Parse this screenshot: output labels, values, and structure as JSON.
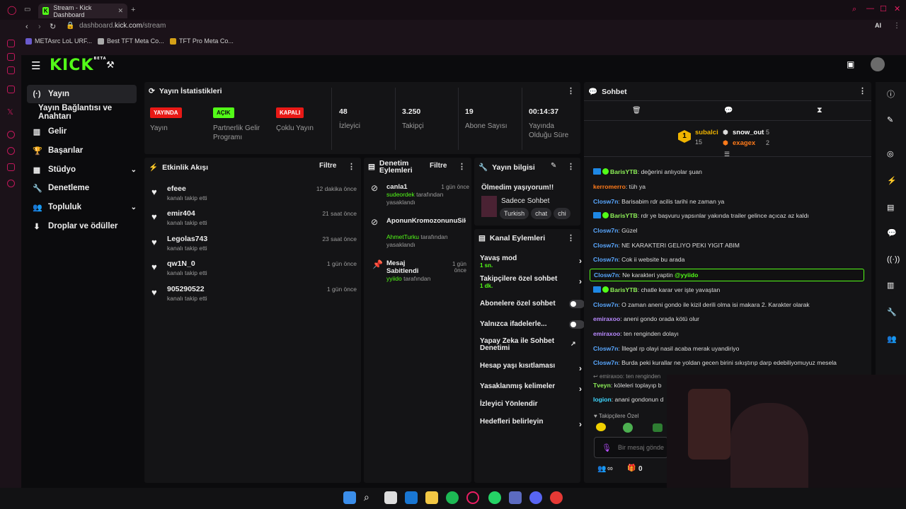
{
  "browser": {
    "tab_title": "Stream - Kick Dashboard",
    "url_host": "dashboard.",
    "url_domain": "kick.com",
    "url_path": "/stream",
    "bookmarks": [
      "METAsrc LoL URF...",
      "Best TFT Meta Co...",
      "TFT Pro Meta Co..."
    ],
    "ai_label": "AI"
  },
  "nav": {
    "logo": "KICK",
    "logo_sup": "BETA",
    "items": [
      {
        "label": "Yayın",
        "icon": "(·)"
      },
      {
        "label": "Yayın Bağlantısı ve Anahtarı",
        "icon": ""
      },
      {
        "label": "Gelir",
        "icon": "▥"
      },
      {
        "label": "Başarılar",
        "icon": "🏆"
      },
      {
        "label": "Stüdyo",
        "icon": "▦"
      },
      {
        "label": "Denetleme",
        "icon": "🔧"
      },
      {
        "label": "Topluluk",
        "icon": "👥"
      },
      {
        "label": "Droplar ve ödüller",
        "icon": "⬇"
      }
    ]
  },
  "stats": {
    "title": "Yayın İstatistikleri",
    "items": [
      {
        "badge": "YAYINDA",
        "label": "Yayın"
      },
      {
        "badge": "AÇIK",
        "label": "Partnerlik Gelir Programı"
      },
      {
        "badge": "KAPALI",
        "label": "Çoklu Yayın"
      },
      {
        "value": "48",
        "label": "İzleyici"
      },
      {
        "value": "3.250",
        "label": "Takipçi"
      },
      {
        "value": "19",
        "label": "Abone Sayısı"
      },
      {
        "value": "00:14:37",
        "label": "Yayında Olduğu Süre"
      }
    ]
  },
  "activity": {
    "title": "Etkinlik Akışı",
    "filter": "Filtre",
    "items": [
      {
        "name": "efeee",
        "sub": "kanalı takip etti",
        "time": "12 dakika önce"
      },
      {
        "name": "emir404",
        "sub": "kanalı takip etti",
        "time": "21 saat önce"
      },
      {
        "name": "Legolas743",
        "sub": "kanalı takip etti",
        "time": "23 saat önce"
      },
      {
        "name": "qw1N_0",
        "sub": "kanalı takip etti",
        "time": "1 gün önce"
      },
      {
        "name": "905290522",
        "sub": "kanalı takip etti",
        "time": "1 gün önce"
      }
    ]
  },
  "moderation": {
    "title": "Denetim Eylemleri",
    "filter": "Filtre",
    "items": [
      {
        "name": "canla1",
        "by": "sudeordek",
        "by_suffix": "tarafından",
        "action": "yasaklandı",
        "time": "1 gün önce"
      },
      {
        "name": "AponunKromozonunuSik",
        "by": "AhmetTurku",
        "by_suffix": "tarafından",
        "action": "yasaklandı",
        "time": ""
      },
      {
        "name": "Mesaj Sabitlendi",
        "by": "yyiido",
        "by_suffix": "tarafından",
        "action": "",
        "time": "1 gün önce"
      }
    ]
  },
  "stream_info": {
    "title": "Yayın bilgisi",
    "stream_title": "Ölmedim yaşıyorum!!",
    "category": "Sadece Sohbet",
    "tags": [
      "Turkish",
      "chat",
      "chi"
    ]
  },
  "channel_actions": {
    "title": "Kanal Eylemleri",
    "items": [
      {
        "label": "Yavaş mod",
        "sub": "1 sn."
      },
      {
        "label": "Takipçilere özel sohbet",
        "sub": "1 dk."
      },
      {
        "label": "Abonelere özel sohbet",
        "sub": ""
      },
      {
        "label": "Yalnızca ifadelerle...",
        "sub": ""
      },
      {
        "label": "Yapay Zeka ile Sohbet Denetimi",
        "sub": ""
      },
      {
        "label": "Hesap yaşı kısıtlaması",
        "sub": ""
      },
      {
        "label": "Yasaklanmış kelimeler",
        "sub": ""
      },
      {
        "label": "İzleyici Yönlendir",
        "sub": ""
      },
      {
        "label": "Hedefleri belirleyin",
        "sub": ""
      }
    ]
  },
  "chat": {
    "title": "Sohbet",
    "top_gifters": [
      {
        "rank": "1",
        "name": "subalci",
        "count": "15"
      },
      {
        "name": "snow_out",
        "count": "5"
      },
      {
        "name": "exagex",
        "count": "2"
      }
    ],
    "messages": [
      {
        "user": "BarisYTB",
        "color": "u-green",
        "badges": true,
        "text": ": değerini anlıyolar şuan"
      },
      {
        "user": "kerromerro",
        "color": "u-orange",
        "badges": false,
        "text": ": tüh ya"
      },
      {
        "user": "Closw7n",
        "color": "u-blue",
        "badges": false,
        "text": ": Barisabim rdr acilis tarihi ne zaman ya"
      },
      {
        "user": "BarisYTB",
        "color": "u-green",
        "badges": true,
        "text": ": rdr ye başvuru yapsınlar yakında trailer gelince açıcaz az kaldı"
      },
      {
        "user": "Closw7n",
        "color": "u-blue",
        "badges": false,
        "text": ": Güzel"
      },
      {
        "user": "Closw7n",
        "color": "u-blue",
        "badges": false,
        "text": ": NE KARAKTERI GELIYO PEKI YIGIT ABIM"
      },
      {
        "user": "Closw7n",
        "color": "u-blue",
        "badges": false,
        "text": ": Cok ii website bu arada"
      },
      {
        "user": "Closw7n",
        "color": "u-blue",
        "badges": false,
        "text": ": Ne karakteri yaptin ",
        "mention": "@yyiido"
      },
      {
        "user": "BarisYTB",
        "color": "u-green",
        "badges": true,
        "text": ": chatle karar ver işte yavaştan"
      },
      {
        "user": "Closw7n",
        "color": "u-blue",
        "badges": false,
        "text": ": O zaman aneni gondo ile kizil derili olma isi makara 2. Karakter olarak"
      },
      {
        "user": "emiraxoo",
        "color": "u-purple",
        "badges": false,
        "text": ": aneni gondo orada kötü olur"
      },
      {
        "user": "emiraxoo",
        "color": "u-purple",
        "badges": false,
        "text": ": ten renginden dolayı"
      },
      {
        "user": "Closw7n",
        "color": "u-blue",
        "badges": false,
        "text": ": İllegal rp olayi nasil acaba merak uyandiriyo"
      },
      {
        "user": "Closw7n",
        "color": "u-blue",
        "badges": false,
        "text": ": Burda peki kurallar ne yoldan gecen birini sıkıştırıp darp edebiliyomuyuz mesela"
      }
    ],
    "reply_hint": "emiraxoo: ten renginden",
    "tail": [
      {
        "user": "Tveyn",
        "color": "u-green",
        "text": ": köleleri toplayıp b"
      },
      {
        "user": "logion",
        "color": "u-cyan",
        "text": ": anani gondonun d"
      }
    ],
    "follower_only": "Takipçilere Özel",
    "input_placeholder": "Bir mesaj gönde",
    "points": "0",
    "infinity": "∞"
  },
  "colors": {
    "accent": "#53fc18",
    "live": "#e91916"
  }
}
